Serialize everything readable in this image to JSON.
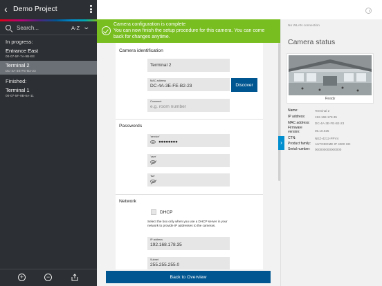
{
  "sidebar": {
    "back_glyph": "‹",
    "title": "Demo Project",
    "search_placeholder": "Search...",
    "sort_label": "A-Z",
    "sections": [
      {
        "label": "In progress:",
        "items": [
          {
            "name": "Entrance East",
            "mac": "00-07-5F-7A-9B-EE",
            "selected": false
          },
          {
            "name": "Terminal 2",
            "mac": "DC-4A-3E-FE-B2-23",
            "selected": true
          }
        ]
      },
      {
        "label": "Finished:",
        "items": [
          {
            "name": "Terminal 1",
            "mac": "00-07-5F-8B-6A-11",
            "selected": false
          }
        ]
      }
    ],
    "footer": {
      "add_glyph": "+",
      "remove_glyph": "−"
    }
  },
  "banner": {
    "title": "Camera configuration is complete",
    "text": "You can now finish the setup procedure for this camera. You can come back for changes anytime."
  },
  "form": {
    "identification": {
      "section_title": "Camera identification",
      "name_value": "Terminal 2",
      "mac_label": "MAC address",
      "mac_value": "DC-4A-3E-FE-B2-23",
      "discover_label": "Discover",
      "comment_label": "Comment",
      "comment_placeholder": "e.g. room number"
    },
    "passwords": {
      "section_title": "Passwords",
      "service_label": "'service'",
      "service_value": "●●●●●●●●",
      "user_label": "'user'",
      "live_label": "'live'"
    },
    "network": {
      "section_title": "Network",
      "dhcp_label": "DHCP",
      "dhcp_help": "Select the box only when you use a DHCP server in your network to provide IP addresses to the cameras.",
      "ip_label": "IP address",
      "ip_value": "192.168.178.35",
      "subnet_label": "Subnet",
      "subnet_value": "255.255.255.0"
    }
  },
  "bottom_button_label": "Back to Overview",
  "camera_status": {
    "wlan_text": "No WLAN connection",
    "title": "Camera status",
    "ready_label": "Ready",
    "rows": [
      {
        "key": "Name:",
        "value": "Terminal 2"
      },
      {
        "key": "IP address:",
        "value": "192.168.178.35"
      },
      {
        "key": "MAC address:",
        "value": "DC-4A-3E-FE-B2-23"
      },
      {
        "key": "Firmware\nversion:",
        "value": "06.10.025"
      },
      {
        "key": "CTN:",
        "value": "NEZ-4212-PPV4"
      },
      {
        "key": "Product family:",
        "value": "AUTODOME IP 4000 HD"
      },
      {
        "key": "Serial number:",
        "value": "000000000000000"
      }
    ]
  },
  "colors": {
    "sidebar_bg": "#2c2f33",
    "selected_bg": "#6b7076",
    "accent_blue": "#005691",
    "banner_green": "#78be20",
    "tab_blue": "#008ecf"
  }
}
